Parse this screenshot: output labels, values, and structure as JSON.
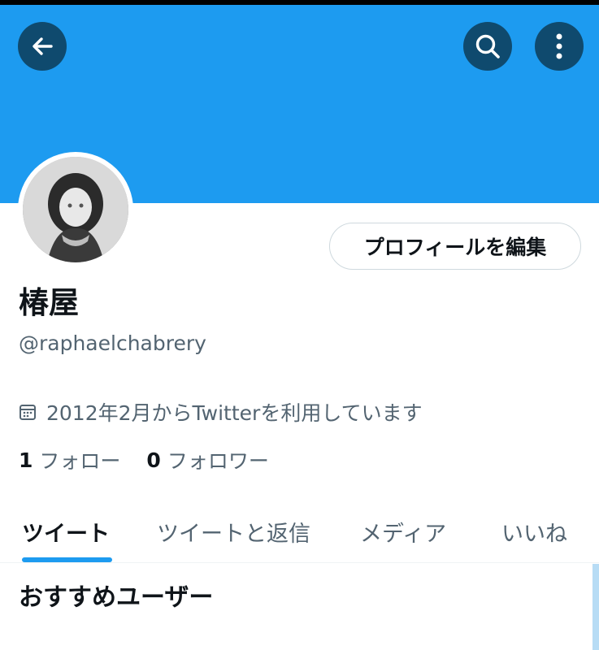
{
  "header": {
    "back_icon": "arrow-left-icon",
    "search_icon": "search-icon",
    "more_icon": "more-vertical-icon",
    "banner_color": "#1d9bf0"
  },
  "profile": {
    "display_name": "椿屋",
    "handle": "@raphaelchabrery",
    "edit_button_label": "プロフィールを編集",
    "joined_icon": "calendar-icon",
    "joined_text": "2012年2月からTwitterを利用しています",
    "following_count": "1",
    "following_label": "フォロー",
    "followers_count": "0",
    "followers_label": "フォロワー"
  },
  "tabs": [
    {
      "label": "ツイート",
      "active": true
    },
    {
      "label": "ツイートと返信",
      "active": false
    },
    {
      "label": "メディア",
      "active": false
    },
    {
      "label": "いいね",
      "active": false
    }
  ],
  "sections": {
    "suggested_title": "おすすめユーザー"
  },
  "colors": {
    "accent": "#1d9bf0",
    "text_primary": "#0f1419",
    "text_secondary": "#536471"
  }
}
